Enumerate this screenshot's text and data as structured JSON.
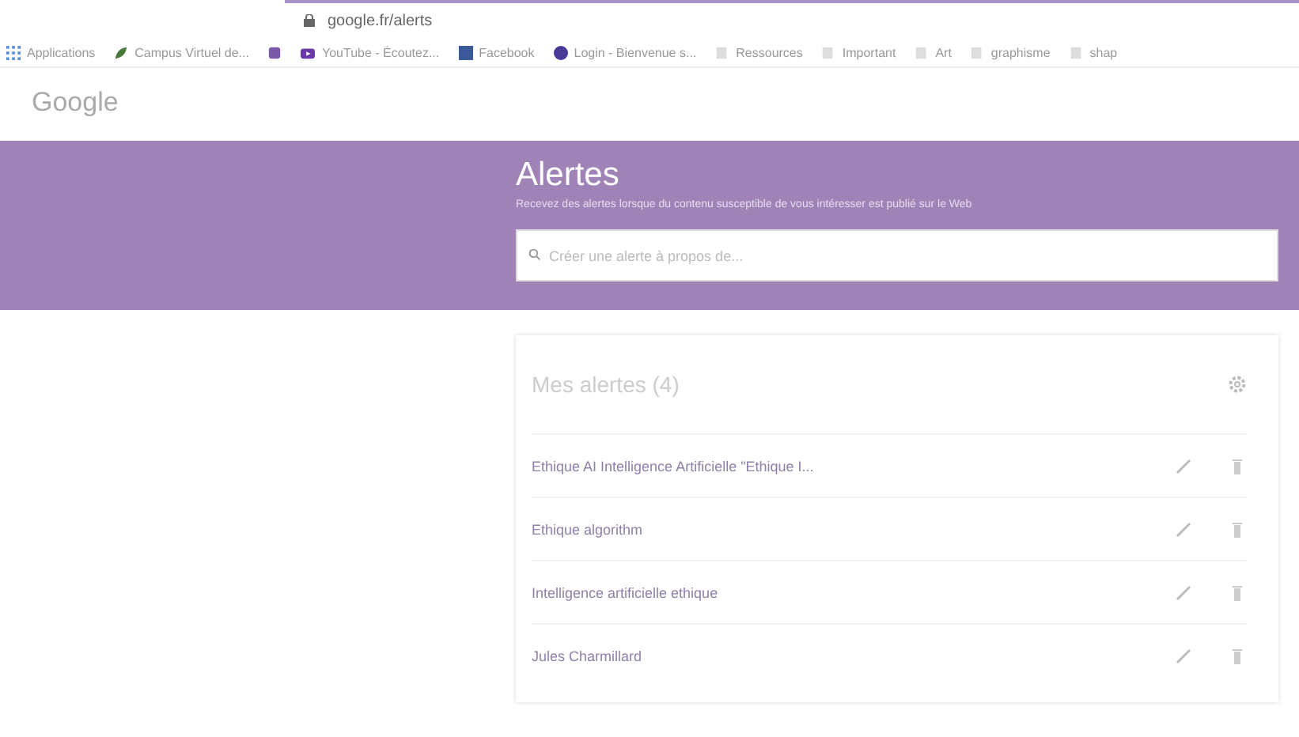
{
  "browser": {
    "url": "google.fr/alerts",
    "bookmarks": [
      {
        "label": "Applications",
        "kind": "apps"
      },
      {
        "label": "Campus Virtuel de...",
        "kind": "leaf"
      },
      {
        "kind": "square"
      },
      {
        "label": "YouTube - Écoutez...",
        "kind": "video"
      },
      {
        "label": "Facebook",
        "kind": "facebook"
      },
      {
        "label": "Login - Bienvenue s...",
        "kind": "circle"
      },
      {
        "label": "Ressources",
        "kind": "folder"
      },
      {
        "label": "Important",
        "kind": "folder"
      },
      {
        "label": "Art",
        "kind": "folder"
      },
      {
        "label": "graphisme",
        "kind": "folder"
      },
      {
        "label": "shap",
        "kind": "folder"
      }
    ]
  },
  "logo": "Google",
  "header": {
    "title": "Alertes",
    "subtitle": "Recevez des alertes lorsque du contenu susceptible de vous intéresser est publié sur le Web",
    "search": {
      "placeholder": "Créer une alerte à propos de..."
    }
  },
  "alerts": {
    "title": "Mes alertes (4)",
    "items": [
      {
        "label": "Ethique AI Intelligence Artificielle \"Ethique I..."
      },
      {
        "label": "Ethique algorithm"
      },
      {
        "label": "Intelligence artificielle ethique"
      },
      {
        "label": "Jules Charmillard"
      }
    ]
  }
}
